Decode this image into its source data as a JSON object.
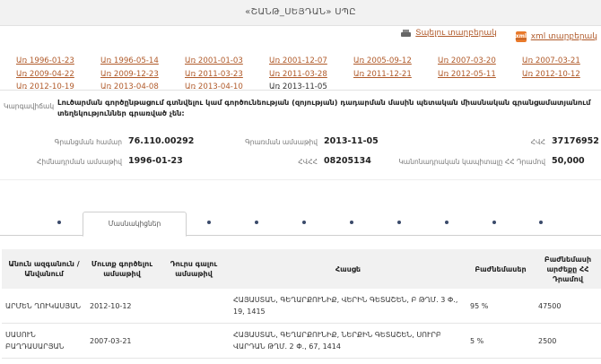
{
  "header": {
    "title": "«ՇԱՆԹ_ՍԵՅԴԱՆ» ՍՊԸ"
  },
  "actions": {
    "print": "Տպելու տարբերակ",
    "xml": "xml տարբերակ"
  },
  "version_links": [
    [
      "Առ 1996-01-23",
      "Առ 1996-05-14",
      "Առ 2001-01-03",
      "Առ 2001-12-07",
      "Առ 2005-09-12",
      "Առ 2007-03-20",
      "Առ 2007-03-21"
    ],
    [
      "Առ 2009-04-22",
      "Առ 2009-12-23",
      "Առ 2011-03-23",
      "Առ 2011-03-28",
      "Առ 2011-12-21",
      "Առ 2012-05-11",
      "Առ 2012-10-12"
    ],
    [
      "Առ 2012-10-19",
      "Առ 2013-04-08",
      "Առ 2013-04-10",
      "Առ 2013-11-05"
    ]
  ],
  "current_version": "Առ 2013-11-05",
  "summary": "Լուծարման գործընթացում գտնվելու կամ գործունեության (զոյության) դադարման մասին պետական միասնական գրանցամատյանում տեղեկություններ գրառված չեն:",
  "summary_label": "Կարգավիճակ",
  "details": {
    "reg_no_label": "Գրանցման համար",
    "reg_no": "76.110.00292",
    "reg_date_label": "Գրառման ամսաթիվ",
    "reg_date": "2013-11-05",
    "hvhh_label": "ՀՎՀ",
    "hvhh": "37176952",
    "state_reg_label": "Հիմնադրման ամսաթիվ",
    "state_reg_date": "1996-01-23",
    "cert_label": "ՀՎՀՀ",
    "cert": "08205134",
    "capital_label": "Կանոնադրական կապիտալը ՀՀ Դրամով",
    "capital": "50,000"
  },
  "tabs": {
    "active": "Մասնակիցներ"
  },
  "table": {
    "headers": [
      "Անուն ազգանուն / Անվանում",
      "Մուտք գործելու ամսաթիվ",
      "Դուրս գալու ամսաթիվ",
      "Հասցե",
      "Բաժնեմասեր",
      "Բաժնեմասի արժեքը ՀՀ Դրամով"
    ],
    "rows": [
      [
        "ԱՐՄԵՆ ՂՈՒԿԱՍՅԱՆ",
        "2012-10-12",
        "",
        "ՀԱՅԱՍՏԱՆ, ԳԵՂԱՐՔՈՒՆԻՔ, ՎԵՐԻՆ ԳԵՏԱՇԵՆ, Բ ԹՂՄ. 3 Փ., 19, 1415",
        "95 %",
        "47500"
      ],
      [
        "ՍԱՍՈՒՆ ԲԱՂԴԱՍԱՐՅԱՆ",
        "2007-03-21",
        "",
        "ՀԱՅԱՍՏԱՆ, ԳԵՂԱՐՔՈՒՆԻՔ, ՆԵՐՔԻՆ ԳԵՏԱՇԵՆ, ՍՈՒՐԲ ՎԱՐԴԱՆ ԹՂՄ. 2 Փ., 67, 1414",
        "5 %",
        "2500"
      ]
    ]
  },
  "colors": {
    "link": "#b05a2a",
    "header_bg": "#f2f2f2",
    "table_head_bg": "#f1f1f1"
  }
}
